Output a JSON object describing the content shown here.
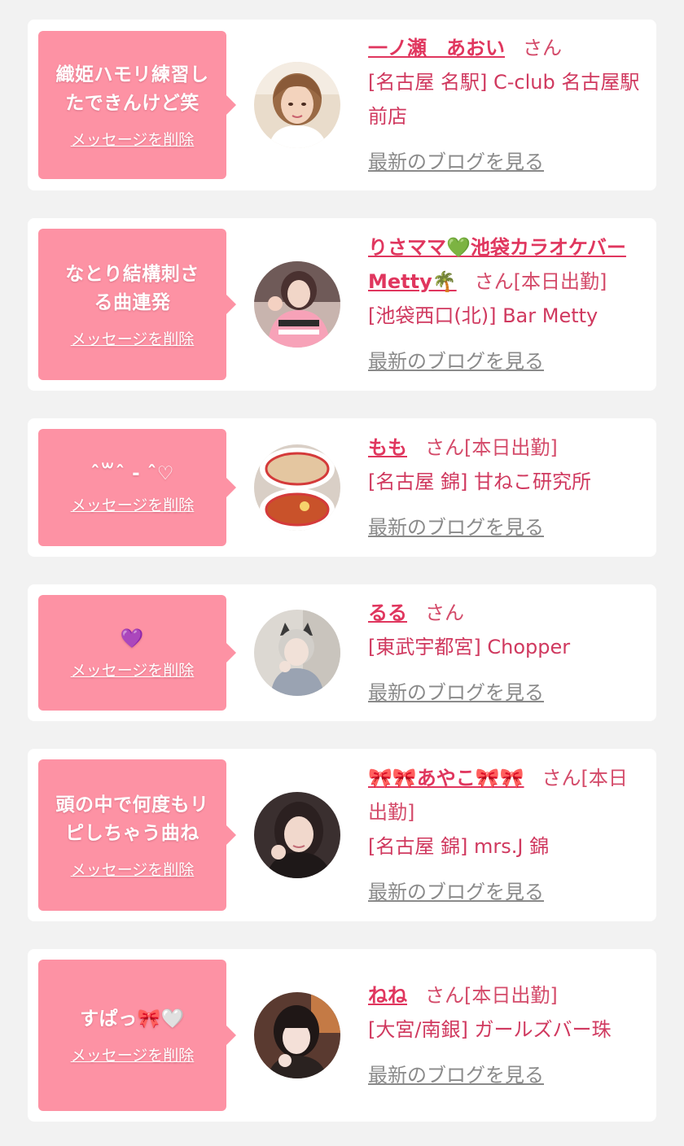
{
  "messages": [
    {
      "bubble_text": "織姫ハモリ練習したできんけど笑",
      "delete_label": "メッセージを削除",
      "name": "一ノ瀬　あおい",
      "suffix": "さん",
      "shop": "[名古屋 名駅] C-club 名古屋駅前店",
      "blog_label": "最新のブログを見る",
      "avatar_icon": "woman-portrait"
    },
    {
      "bubble_text": "なとり結構刺さる曲連発",
      "delete_label": "メッセージを削除",
      "name": "りさママ💚池袋カラオケバーMetty🌴",
      "suffix": "さん[本日出勤]",
      "shop": "[池袋西口(北)] Bar Metty",
      "blog_label": "最新のブログを見る",
      "avatar_icon": "woman-in-jersey"
    },
    {
      "bubble_text": "ˆ꒳ˆ ‐ ˆ♡",
      "delete_label": "メッセージを削除",
      "name": "もも",
      "suffix": "さん[本日出勤]",
      "shop": "[名古屋 錦] 甘ねこ研究所",
      "blog_label": "最新のブログを見る",
      "avatar_icon": "ramen-bowls"
    },
    {
      "bubble_text": "💜",
      "delete_label": "メッセージを削除",
      "name": "るる",
      "suffix": "さん",
      "shop": "[東武宇都宮] Chopper",
      "blog_label": "最新のブログを見る",
      "avatar_icon": "cat-ear-woman"
    },
    {
      "bubble_text": "頭の中で何度もリピしちゃう曲ね",
      "delete_label": "メッセージを削除",
      "name": "🎀🎀あやこ🎀🎀",
      "suffix": "さん[本日出勤]",
      "shop": "[名古屋 錦] mrs.J 錦",
      "blog_label": "最新のブログを見る",
      "avatar_icon": "woman-selfie"
    },
    {
      "bubble_text": "すぱっ🎀🤍",
      "delete_label": "メッセージを削除",
      "name": "ねね",
      "suffix": "さん[本日出勤]",
      "shop": "[大宮/南銀] ガールズバー珠",
      "blog_label": "最新のブログを見る",
      "avatar_icon": "woman-bangs"
    }
  ],
  "colors": {
    "page_background": "#f2f2f2",
    "card_background": "#ffffff",
    "bubble": "#fd92a4",
    "name_text": "#e0365e",
    "shop_text": "#d0395f",
    "blog_link": "#8a8a8a"
  }
}
